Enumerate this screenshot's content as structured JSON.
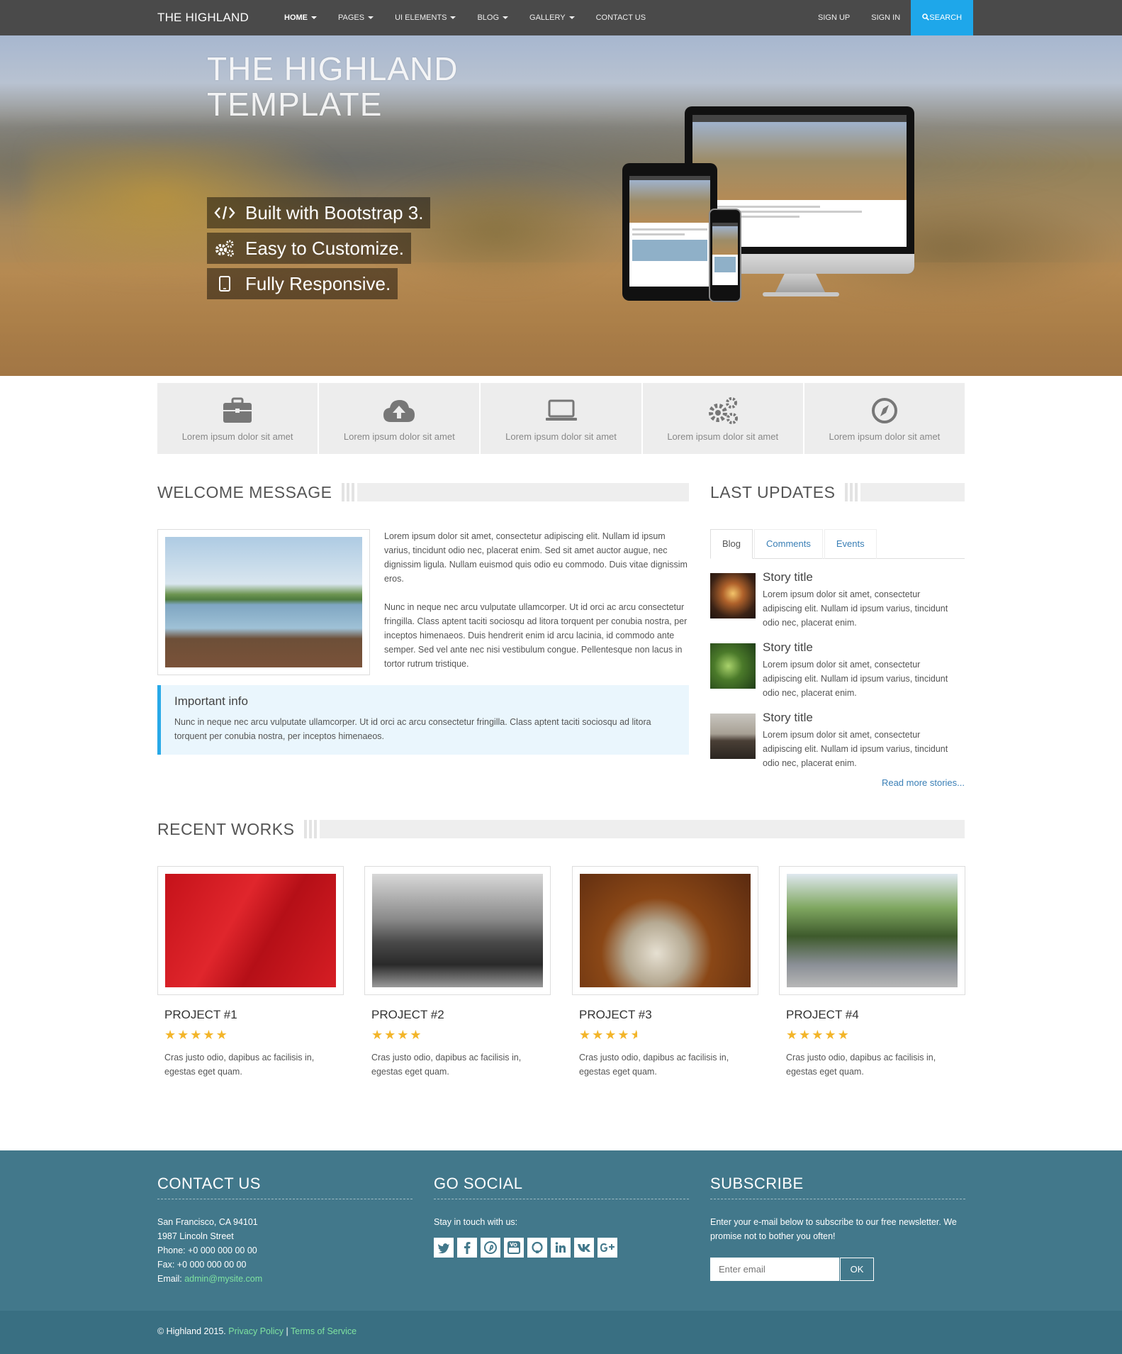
{
  "nav": {
    "brand": "THE HIGHLAND",
    "items": [
      {
        "label": "HOME",
        "caret": true
      },
      {
        "label": "PAGES",
        "caret": true
      },
      {
        "label": "UI ELEMENTS",
        "caret": true
      },
      {
        "label": "BLOG",
        "caret": true
      },
      {
        "label": "GALLERY",
        "caret": true
      },
      {
        "label": "CONTACT US",
        "caret": false
      }
    ],
    "sign_up": "SIGN UP",
    "sign_in": "SIGN IN",
    "search": "SEARCH"
  },
  "hero": {
    "title_line1": "THE HIGHLAND",
    "title_line2": "TEMPLATE",
    "features": [
      {
        "icon": "code-icon",
        "label": "Built with Bootstrap 3."
      },
      {
        "icon": "gears-icon",
        "label": "Easy to Customize."
      },
      {
        "icon": "tablet-icon",
        "label": "Fully Responsive."
      }
    ]
  },
  "features": [
    {
      "icon": "briefcase-icon",
      "label": "Lorem ipsum dolor sit amet"
    },
    {
      "icon": "cloud-upload-icon",
      "label": "Lorem ipsum dolor sit amet"
    },
    {
      "icon": "laptop-icon",
      "label": "Lorem ipsum dolor sit amet"
    },
    {
      "icon": "gears-icon",
      "label": "Lorem ipsum dolor sit amet"
    },
    {
      "icon": "compass-icon",
      "label": "Lorem ipsum dolor sit amet"
    }
  ],
  "welcome": {
    "heading": "WELCOME MESSAGE",
    "para1": "Lorem ipsum dolor sit amet, consectetur adipiscing elit. Nullam id ipsum varius, tincidunt odio nec, placerat enim. Sed sit amet auctor augue, nec dignissim ligula. Nullam euismod quis odio eu commodo. Duis vitae dignissim eros.",
    "para2": "Nunc in neque nec arcu vulputate ullamcorper. Ut id orci ac arcu consectetur fringilla. Class aptent taciti sociosqu ad litora torquent per conubia nostra, per inceptos himenaeos. Duis hendrerit enim id arcu lacinia, id commodo ante semper. Sed vel ante nec nisi vestibulum congue. Pellentesque non lacus in tortor rutrum tristique.",
    "info_title": "Important info",
    "info_body": "Nunc in neque nec arcu vulputate ullamcorper. Ut id orci ac arcu consectetur fringilla. Class aptent taciti sociosqu ad litora torquent per conubia nostra, per inceptos himenaeos."
  },
  "updates": {
    "heading": "LAST UPDATES",
    "tabs": [
      "Blog",
      "Comments",
      "Events"
    ],
    "active_tab": "Blog",
    "stories": [
      {
        "title": "Story title",
        "body": "Lorem ipsum dolor sit amet, consectetur adipiscing elit. Nullam id ipsum varius, tincidunt odio nec, placerat enim."
      },
      {
        "title": "Story title",
        "body": "Lorem ipsum dolor sit amet, consectetur adipiscing elit. Nullam id ipsum varius, tincidunt odio nec, placerat enim."
      },
      {
        "title": "Story title",
        "body": "Lorem ipsum dolor sit amet, consectetur adipiscing elit. Nullam id ipsum varius, tincidunt odio nec, placerat enim."
      }
    ],
    "read_more": "Read more stories..."
  },
  "works": {
    "heading": "RECENT WORKS",
    "projects": [
      {
        "title": "PROJECT #1",
        "rating": 5,
        "desc": "Cras justo odio, dapibus ac facilisis in, egestas eget quam."
      },
      {
        "title": "PROJECT #2",
        "rating": 4,
        "desc": "Cras justo odio, dapibus ac facilisis in, egestas eget quam."
      },
      {
        "title": "PROJECT #3",
        "rating": 4.5,
        "desc": "Cras justo odio, dapibus ac facilisis in, egestas eget quam."
      },
      {
        "title": "PROJECT #4",
        "rating": 5,
        "desc": "Cras justo odio, dapibus ac facilisis in, egestas eget quam."
      }
    ]
  },
  "footer": {
    "contact_heading": "CONTACT US",
    "address1": "San Francisco, CA 94101",
    "address2": "1987 Lincoln Street",
    "phone": "Phone: +0 000 000 00 00",
    "fax": "Fax: +0 000 000 00 00",
    "email_label": "Email: ",
    "email": "admin@mysite.com",
    "social_heading": "GO SOCIAL",
    "social_text": "Stay in touch with us:",
    "social_icons": [
      "twitter-icon",
      "facebook-icon",
      "pinterest-icon",
      "youtube-icon",
      "github-icon",
      "linkedin-icon",
      "vk-icon",
      "google-plus-icon"
    ],
    "subscribe_heading": "SUBSCRIBE",
    "subscribe_text": "Enter your e-mail below to subscribe to our free newsletter. We promise not to bother you often!",
    "email_placeholder": "Enter email",
    "ok": "OK",
    "copyright": "© Highland 2015.",
    "privacy": "Privacy Policy",
    "separator": "|",
    "terms": "Terms of Service"
  },
  "colors": {
    "accent": "#1ea7ea",
    "nav_bg": "#4a4a4a",
    "footer_bg": "#42788b",
    "link": "#3a7fb6",
    "star": "#f3b52a"
  }
}
